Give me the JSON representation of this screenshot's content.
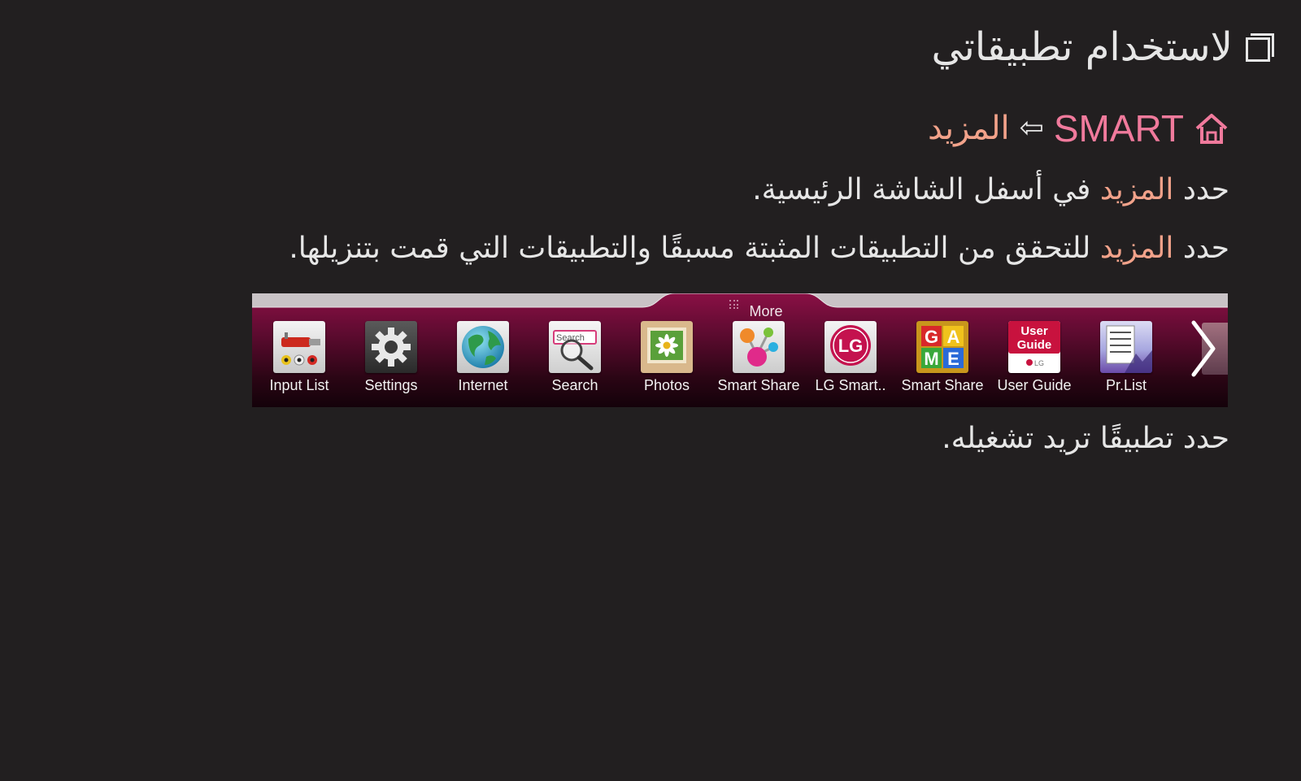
{
  "title": "لاستخدام تطبيقاتي",
  "path": {
    "smart_label": "SMART",
    "arrow": "⇦",
    "more_label": "المزيد"
  },
  "line1": {
    "prefix": "حدد ",
    "highlight": "المزيد",
    "suffix": " في أسفل الشاشة الرئيسية."
  },
  "line2": {
    "prefix": "حدد ",
    "highlight": "المزيد",
    "suffix": " للتحقق من التطبيقات المثبتة مسبقًا والتطبيقات التي قمت بتنزيلها."
  },
  "line3": "حدد تطبيقًا تريد تشغيله.",
  "launcher": {
    "more_tab_label": "More",
    "apps": [
      {
        "label": "Input List",
        "icon": "input-list-icon"
      },
      {
        "label": "Settings",
        "icon": "settings-gear-icon"
      },
      {
        "label": "Internet",
        "icon": "internet-globe-icon"
      },
      {
        "label": "Search",
        "icon": "search-magnifier-icon"
      },
      {
        "label": "Photos",
        "icon": "photos-flower-icon"
      },
      {
        "label": "Smart Share",
        "icon": "smart-share-icon"
      },
      {
        "label": "LG Smart..",
        "icon": "lg-logo-icon"
      },
      {
        "label": "Smart Share",
        "icon": "game-blocks-icon"
      },
      {
        "label": "User Guide",
        "icon": "user-guide-icon"
      },
      {
        "label": "Pr.List",
        "icon": "program-list-icon"
      }
    ],
    "icon_texts": {
      "search": "Search",
      "lg": "LG",
      "game_letters": [
        "G",
        "A",
        "M",
        "E"
      ],
      "guide_line1": "User",
      "guide_line2": "Guide",
      "guide_brand": "LG"
    }
  },
  "colors": {
    "background": "#221f20",
    "text": "#e6e6e6",
    "highlight": "#f2a28a",
    "smart_pink": "#f07a9c",
    "bar_top": "#8a1045"
  }
}
